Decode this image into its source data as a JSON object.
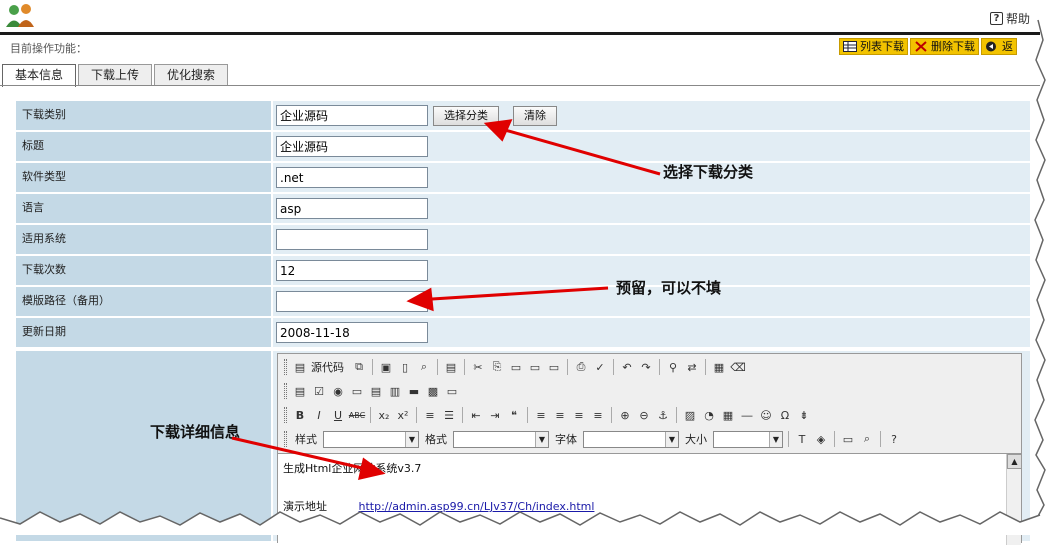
{
  "header": {
    "help_label": "帮助"
  },
  "opbar": {
    "label": "目前操作功能：",
    "actions": [
      "列表下载",
      "删除下载",
      "返"
    ]
  },
  "tabs": [
    "基本信息",
    "下载上传",
    "优化搜索"
  ],
  "form": {
    "rows": [
      {
        "label": "下载类别",
        "value": "企业源码"
      },
      {
        "label": "标题",
        "value": "企业源码"
      },
      {
        "label": "软件类型",
        "value": ".net"
      },
      {
        "label": "语言",
        "value": "asp"
      },
      {
        "label": "适用系统",
        "value": ""
      },
      {
        "label": "下载次数",
        "value": "12"
      },
      {
        "label": "模版路径（备用）",
        "value": ""
      },
      {
        "label": "更新日期",
        "value": "2008-11-18"
      }
    ],
    "choose_category_button": "选择分类",
    "clear_button": "清除"
  },
  "editor": {
    "source_label": "源代码",
    "style_label": "样式",
    "format_label": "格式",
    "font_label": "字体",
    "size_label": "大小",
    "content_line1": "生成Html企业网站系统v3.7",
    "content_label2": "演示地址",
    "content_link": "http://admin.asp99.cn/LJv37/Ch/index.html"
  },
  "annotations": {
    "category": "选择下载分类",
    "reserved": "预留，可以不填",
    "details": "下载详细信息"
  },
  "colors": {
    "label_bg": "#c4d9e6",
    "value_bg": "#e2edf4",
    "action_bg": "#f2c300",
    "arrow": "#e00000"
  }
}
